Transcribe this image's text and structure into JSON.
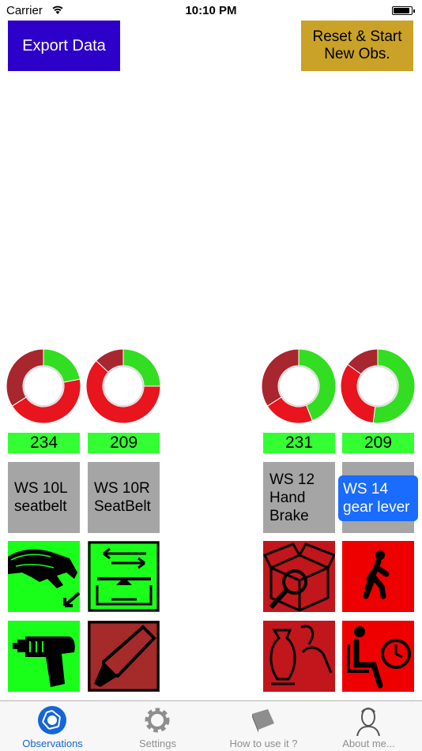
{
  "status_bar": {
    "carrier": "Carrier",
    "time": "10:10 PM"
  },
  "actions": {
    "export_label": "Export Data",
    "reset_label": "Reset & Start New Obs."
  },
  "stations": [
    {
      "count": "234",
      "label": "WS 10L seatbelt",
      "ring": {
        "green": 0.22,
        "red": 0.44,
        "darkred": 0.34
      },
      "tiles": [
        {
          "icon": "hand-reaching-icon",
          "color": "green"
        },
        {
          "icon": "power-drill-icon",
          "color": "green"
        }
      ]
    },
    {
      "count": "209",
      "label": "WS 10R SeatBelt",
      "ring": {
        "green": 0.25,
        "red": 0.62,
        "darkred": 0.13
      },
      "tiles": [
        {
          "icon": "transport-conveyor-icon",
          "color": "green"
        },
        {
          "icon": "marker-pen-icon",
          "color": "brick"
        }
      ]
    },
    {
      "count": "231",
      "label": "WS 12 Hand Brake",
      "ring": {
        "green": 0.44,
        "red": 0.22,
        "darkred": 0.34
      },
      "tiles": [
        {
          "icon": "box-inspect-icon",
          "color": "darkred"
        },
        {
          "icon": "vase-hand-icon",
          "color": "darkred"
        }
      ]
    },
    {
      "count": "209",
      "label": "WS 14 gear lever",
      "ring": {
        "green": 0.52,
        "red": 0.33,
        "darkred": 0.15
      },
      "tiles": [
        {
          "icon": "walking-person-icon",
          "color": "red"
        },
        {
          "icon": "waiting-clock-icon",
          "color": "red"
        }
      ]
    }
  ],
  "tabs": [
    {
      "label": "Observations",
      "icon": "aperture-icon",
      "active": true
    },
    {
      "label": "Settings",
      "icon": "gear-icon",
      "active": false
    },
    {
      "label": "How to use it ?",
      "icon": "book-icon",
      "active": false
    },
    {
      "label": "About me...",
      "icon": "portrait-icon",
      "active": false
    }
  ]
}
